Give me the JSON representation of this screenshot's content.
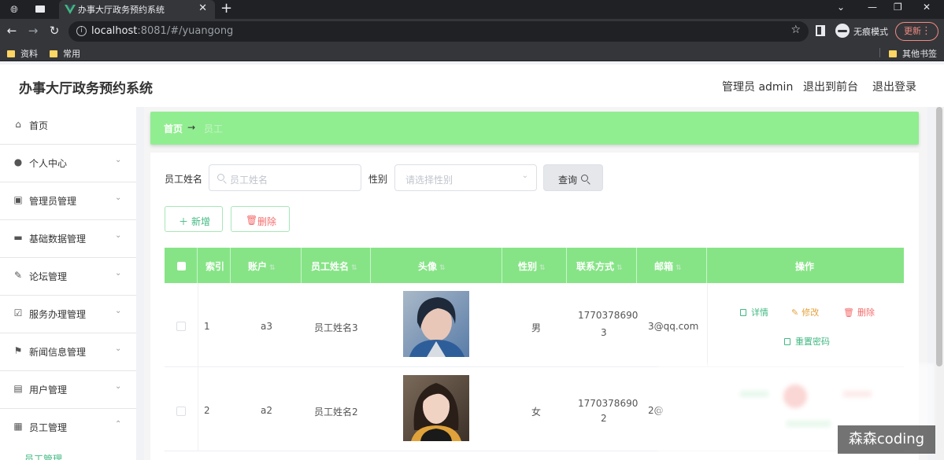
{
  "browser": {
    "tab_title": "办事大厅政务预约系统",
    "url_host": "localhost",
    "url_rest": ":8081/#/yuangong",
    "incognito_label": "无痕模式",
    "update_label": "更新",
    "bookmarks": [
      "资料",
      "常用"
    ],
    "other_bookmarks": "其他书签",
    "icons": [
      "globe-icon",
      "tab-icon",
      "vue-logo-icon",
      "back-icon",
      "forward-icon",
      "reload-icon",
      "star-icon",
      "incognito-icon"
    ]
  },
  "header": {
    "title": "办事大厅政务预约系统",
    "admin": "管理员 admin",
    "to_front": "退出到前台",
    "logout": "退出登录"
  },
  "sidebar": {
    "items": [
      {
        "label": "首页",
        "icon": "home-icon"
      },
      {
        "label": "个人中心",
        "icon": "user-icon"
      },
      {
        "label": "管理员管理",
        "icon": "clipboard-icon"
      },
      {
        "label": "基础数据管理",
        "icon": "monitor-icon"
      },
      {
        "label": "论坛管理",
        "icon": "edit-icon"
      },
      {
        "label": "服务办理管理",
        "icon": "checklist-icon"
      },
      {
        "label": "新闻信息管理",
        "icon": "flag-icon"
      },
      {
        "label": "用户管理",
        "icon": "document-icon"
      },
      {
        "label": "员工管理",
        "icon": "grid-icon"
      }
    ],
    "submenu_active": "员工管理"
  },
  "breadcrumb": {
    "home": "首页",
    "current": "员工"
  },
  "search": {
    "name_label": "员工姓名",
    "name_placeholder": "员工姓名",
    "gender_label": "性别",
    "gender_placeholder": "请选择性别",
    "query": "查询"
  },
  "actions": {
    "add": "新增",
    "delete": "删除"
  },
  "table": {
    "headers": [
      "索引",
      "账户",
      "员工姓名",
      "头像",
      "性别",
      "联系方式",
      "邮箱",
      "操作"
    ],
    "rows": [
      {
        "index": "1",
        "account": "a3",
        "name": "员工姓名3",
        "gender": "男",
        "phone_1": "1770378690",
        "phone_2": "3",
        "email": "3@qq.com"
      },
      {
        "index": "2",
        "account": "a2",
        "name": "员工姓名2",
        "gender": "女",
        "phone_1": "1770378690",
        "phone_2": "2",
        "email": "2@"
      }
    ],
    "ops": {
      "detail": "详情",
      "edit": "修改",
      "delete": "删除",
      "reset": "重置密码"
    }
  },
  "watermark": "森森coding",
  "colors": {
    "accent": "#90ee90",
    "header_green": "#86e486",
    "link_green": "#42b983",
    "danger": "#f56c6c",
    "edit": "#e6a23c"
  }
}
